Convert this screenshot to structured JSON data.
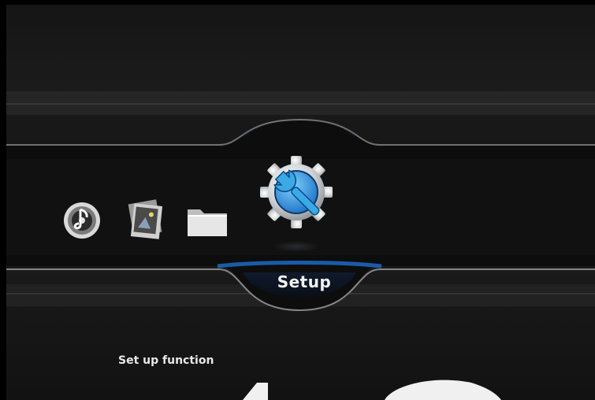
{
  "menu": {
    "items": [
      {
        "id": "music",
        "icon": "music-disc-icon"
      },
      {
        "id": "photo",
        "icon": "photo-stack-icon"
      },
      {
        "id": "files",
        "icon": "folder-icon"
      },
      {
        "id": "setup",
        "icon": "setup-gear-icon"
      }
    ],
    "selected_index": 3,
    "selected_label": "Setup"
  },
  "description": "Set up function",
  "colors": {
    "background": "#181818",
    "accent_blue": "#1d6fc4",
    "gear_gray": "#cfd3d6",
    "wrench_cyan": "#3aa9e6",
    "text": "#f0f0f0"
  }
}
